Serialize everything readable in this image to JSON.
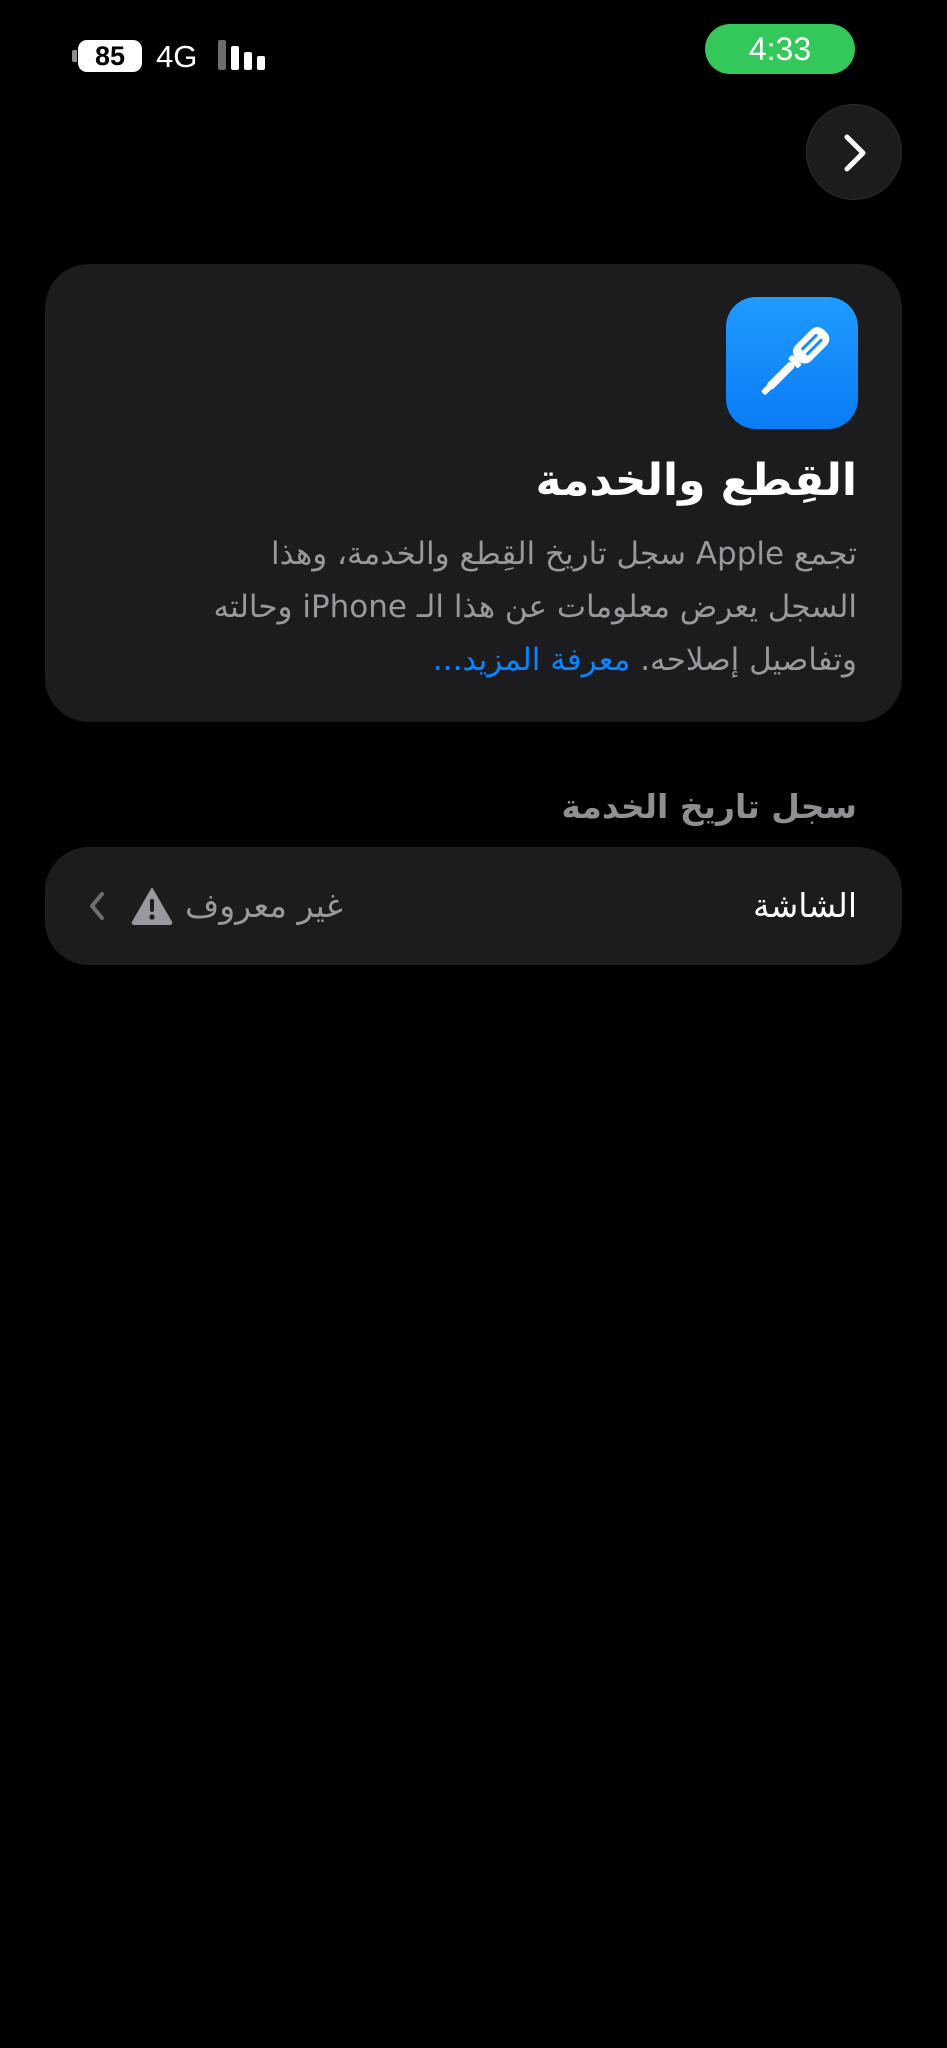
{
  "status_bar": {
    "battery_level": "85",
    "network_type": "4G",
    "time": "4:33",
    "time_pill_color": "#34c759"
  },
  "nav": {
    "forward_icon": "chevron-right-icon"
  },
  "info_card": {
    "icon": "screwdriver-icon",
    "icon_color": "#0a84ff",
    "title": "القِطع والخدمة",
    "description_lines": [
      "تجمع Apple سجل تاريخ القِطع والخدمة، وهذا",
      "السجل يعرض معلومات عن هذا الـ iPhone وحالته",
      "وتفاصيل إصلاحه."
    ],
    "learn_more": "معرفة المزيد..."
  },
  "service_history": {
    "header": "سجل تاريخ الخدمة",
    "rows": [
      {
        "label": "الشاشة",
        "status": "غير معروف",
        "status_icon": "warning-icon"
      }
    ]
  },
  "colors": {
    "background": "#000000",
    "card": "#1c1c1e",
    "secondary_text": "#98989e",
    "link": "#0a84ff"
  }
}
